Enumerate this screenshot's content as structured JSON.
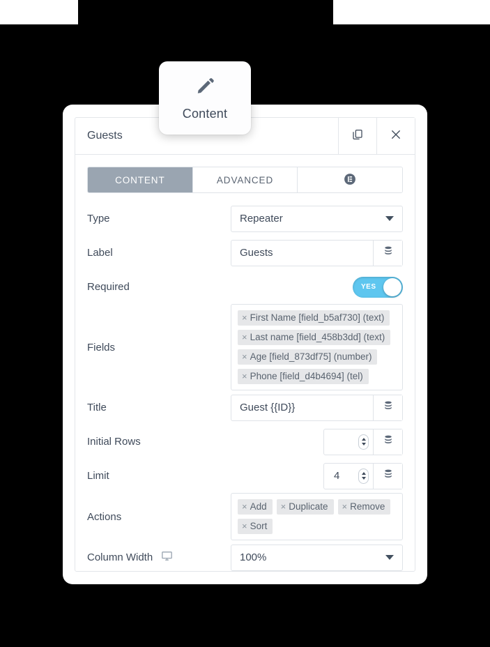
{
  "content_tab": {
    "label": "Content",
    "icon": "pencil-icon"
  },
  "panel": {
    "title": "Guests",
    "header_actions": [
      {
        "name": "duplicate-button",
        "icon": "copy-icon"
      },
      {
        "name": "close-button",
        "icon": "close-icon"
      }
    ],
    "tabs": [
      {
        "label": "CONTENT",
        "active": true
      },
      {
        "label": "ADVANCED",
        "active": false
      },
      {
        "label": "",
        "icon": "elementor-logo-icon",
        "active": false
      }
    ],
    "fields": {
      "type": {
        "label": "Type",
        "value": "Repeater",
        "control": "select"
      },
      "label": {
        "label": "Label",
        "value": "Guests",
        "placeholder": "",
        "control": "text",
        "dynamic_icon": "database-icon"
      },
      "required": {
        "label": "Required",
        "value": "YES",
        "on": true,
        "control": "toggle"
      },
      "fields_list": {
        "label": "Fields",
        "control": "tags",
        "tags": [
          "First Name [field_b5af730] (text)",
          "Last name [field_458b3dd] (text)",
          "Age [field_873df75] (number)",
          "Phone [field_d4b4694] (tel)"
        ]
      },
      "title": {
        "label": "Title",
        "value": "Guest {{ID}}",
        "placeholder": "",
        "control": "text",
        "dynamic_icon": "database-icon"
      },
      "initial_rows": {
        "label": "Initial Rows",
        "value": "",
        "placeholder": "",
        "control": "number",
        "dynamic_icon": "database-icon"
      },
      "limit": {
        "label": "Limit",
        "value": "4",
        "placeholder": "",
        "control": "number",
        "dynamic_icon": "database-icon"
      },
      "actions": {
        "label": "Actions",
        "control": "tags",
        "tags": [
          "Add",
          "Duplicate",
          "Remove",
          "Sort"
        ]
      },
      "column_width": {
        "label": "Column Width",
        "device_icon": "desktop-icon",
        "value": "100%",
        "control": "select"
      }
    }
  },
  "colors": {
    "accent_toggle": "#5ec6ef",
    "tab_active_bg": "#9aa5b1",
    "text": "#3f4a5a",
    "border": "#dfe3e8",
    "tag_bg": "#e6e7e9",
    "backdrop": "#000000"
  },
  "tag_remove_glyph": "×"
}
